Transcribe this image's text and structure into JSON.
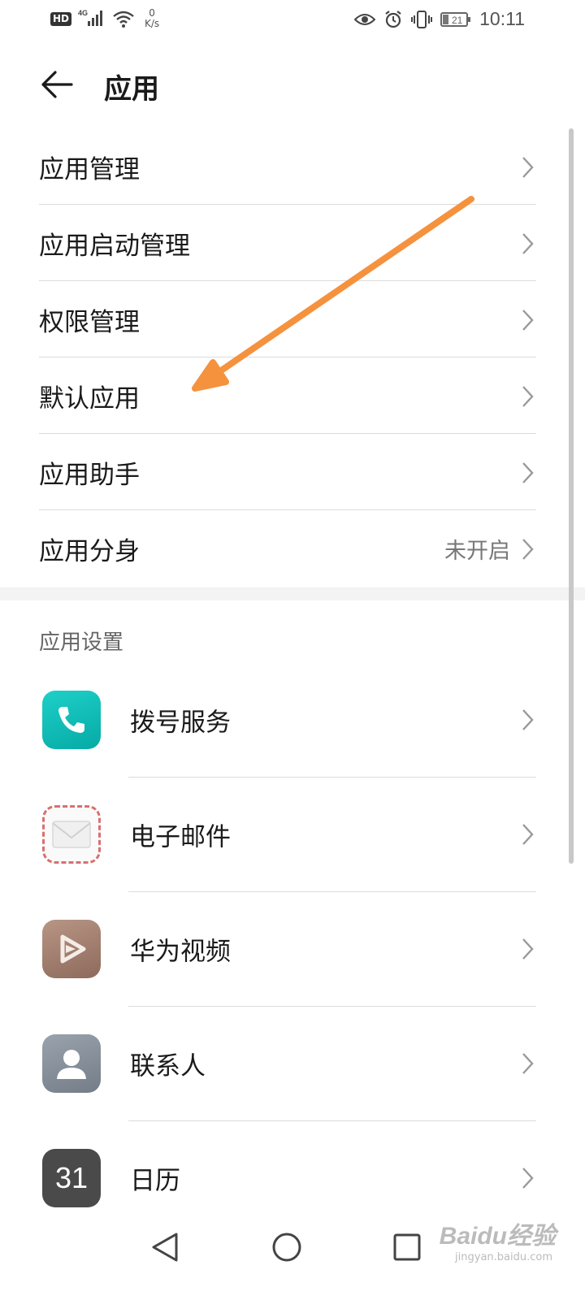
{
  "status_bar": {
    "hd": "HD",
    "network": "4G",
    "speed_value": "0",
    "speed_unit": "K/s",
    "battery": "21",
    "time": "10:11"
  },
  "header": {
    "title": "应用"
  },
  "menu": {
    "items": [
      {
        "label": "应用管理",
        "value": ""
      },
      {
        "label": "应用启动管理",
        "value": ""
      },
      {
        "label": "权限管理",
        "value": ""
      },
      {
        "label": "默认应用",
        "value": ""
      },
      {
        "label": "应用助手",
        "value": ""
      },
      {
        "label": "应用分身",
        "value": "未开启"
      }
    ]
  },
  "app_settings": {
    "section_title": "应用设置",
    "apps": [
      {
        "label": "拨号服务",
        "icon": "phone-icon"
      },
      {
        "label": "电子邮件",
        "icon": "mail-icon"
      },
      {
        "label": "华为视频",
        "icon": "video-icon"
      },
      {
        "label": "联系人",
        "icon": "contacts-icon"
      },
      {
        "label": "日历",
        "icon": "calendar-icon",
        "icon_text": "31"
      }
    ]
  },
  "annotation": {
    "arrow_color": "#f5923e"
  },
  "watermark": {
    "text": "Baidu经验",
    "sub": "jingyan.baidu.com"
  }
}
